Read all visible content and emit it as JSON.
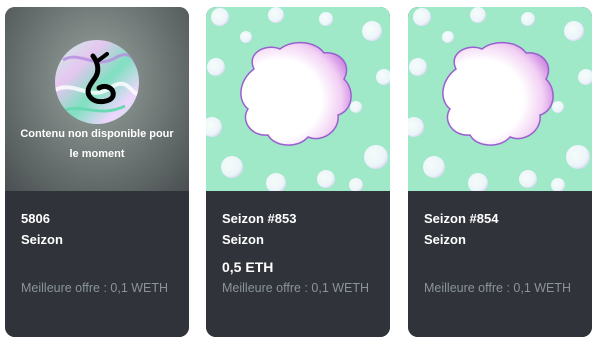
{
  "cards": [
    {
      "unavailable_text": "Contenu non disponible pour le moment",
      "name": "5806",
      "collection": "Seizon",
      "price": "",
      "best_offer": "Meilleure offre : 0,1 WETH"
    },
    {
      "name": "Seizon #853",
      "collection": "Seizon",
      "price": "0,5 ETH",
      "best_offer": "Meilleure offre : 0,1 WETH"
    },
    {
      "name": "Seizon #854",
      "collection": "Seizon",
      "price": "",
      "best_offer": "Meilleure offre : 0,1 WETH"
    }
  ],
  "colors": {
    "card_bg": "#303339",
    "mint_bg": "#9fe8c8",
    "text_primary": "#ffffff",
    "text_secondary": "#8a939b"
  }
}
